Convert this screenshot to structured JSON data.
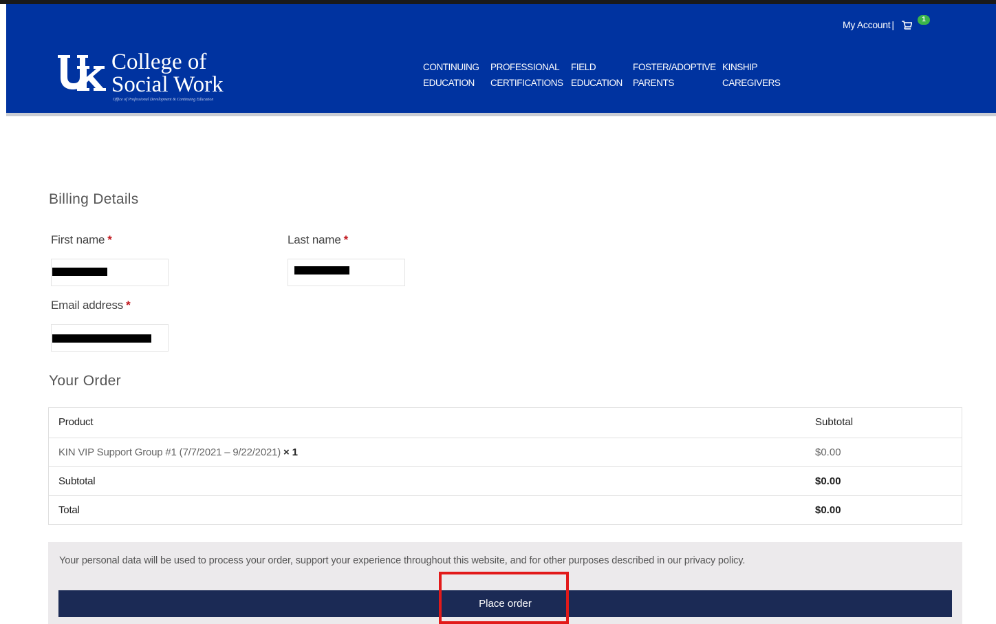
{
  "header": {
    "logo": {
      "line1": "College of",
      "line2": "Social Work",
      "tagline": "Office of Professional Development & Continuing Education",
      "mark_icon": "uk-logo-icon"
    },
    "account": {
      "label": "My Account",
      "separator": "|",
      "cart_icon": "cart-icon",
      "cart_count": "1"
    },
    "nav": [
      {
        "label_line1": "CONTINUING",
        "label_line2": "EDUCATION"
      },
      {
        "label_line1": "PROFESSIONAL",
        "label_line2": "CERTIFICATIONS"
      },
      {
        "label_line1": "FIELD",
        "label_line2": "EDUCATION"
      },
      {
        "label_line1": "FOSTER/ADOPTIVE",
        "label_line2": "PARENTS"
      },
      {
        "label_line1": "KINSHIP",
        "label_line2": "CAREGIVERS"
      }
    ]
  },
  "billing": {
    "title": "Billing Details",
    "required_mark": "*",
    "first_name": {
      "label": "First name",
      "value": ""
    },
    "last_name": {
      "label": "Last name",
      "value": ""
    },
    "email": {
      "label": "Email address",
      "value": ""
    }
  },
  "order": {
    "title": "Your Order",
    "columns": {
      "product": "Product",
      "subtotal": "Subtotal"
    },
    "items": [
      {
        "name": "KIN VIP Support Group #1 (7/7/2021 – 9/22/2021)",
        "qty": "× 1",
        "price": "$0.00"
      }
    ],
    "subtotal": {
      "label": "Subtotal",
      "value": "$0.00"
    },
    "total": {
      "label": "Total",
      "value": "$0.00"
    }
  },
  "payment": {
    "privacy_text": "Your personal data will be used to process your order, support your experience throughout this website, and for other purposes described in our privacy policy.",
    "place_order_label": "Place order"
  },
  "colors": {
    "header_blue": "#0033a0",
    "button_navy": "#1b2a55",
    "required_red": "#c0151b",
    "highlight_red": "#e21a1a",
    "badge_green": "#3bb54a"
  }
}
